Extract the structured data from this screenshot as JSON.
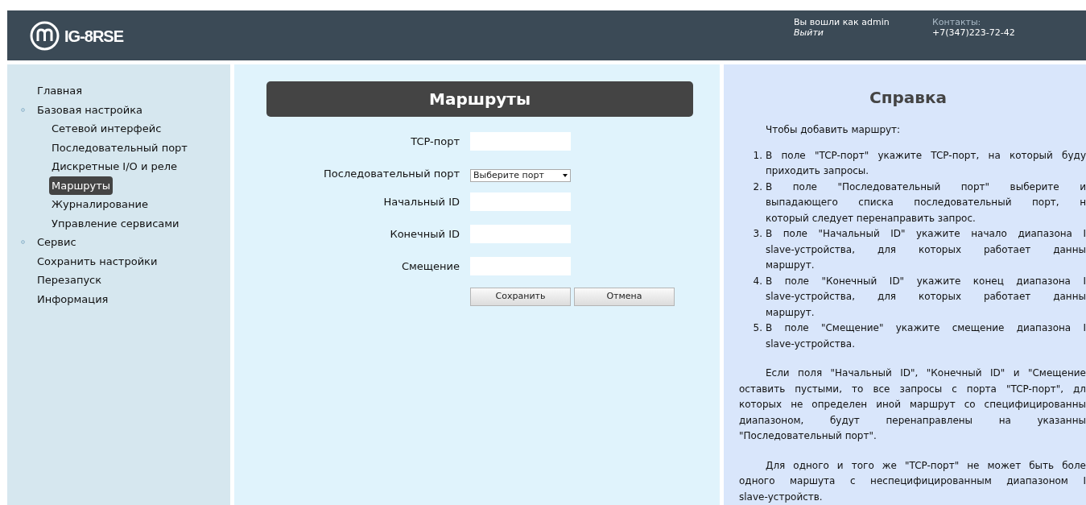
{
  "header": {
    "product": "IG-8RSE",
    "login_text": "Вы вошли как admin",
    "logout": "Выйти",
    "contacts_label": "Контакты:",
    "phone": "+7(347)223-72-42"
  },
  "sidebar": {
    "items": [
      {
        "label": "Главная",
        "kind": "link",
        "selected": false
      },
      {
        "label": "Базовая настройка",
        "kind": "group",
        "selected": false,
        "children": [
          {
            "label": "Сетевой интерфейс",
            "selected": false
          },
          {
            "label": "Последовательный порт",
            "selected": false
          },
          {
            "label": "Дискретные I/O и реле",
            "selected": false
          },
          {
            "label": "Маршруты",
            "selected": true
          },
          {
            "label": "Журналирование",
            "selected": false
          },
          {
            "label": "Управление сервисами",
            "selected": false
          }
        ]
      },
      {
        "label": "Сервис",
        "kind": "group",
        "selected": false
      },
      {
        "label": "Сохранить настройки",
        "kind": "link",
        "selected": false
      },
      {
        "label": "Перезапуск",
        "kind": "link",
        "selected": false
      },
      {
        "label": "Информация",
        "kind": "link",
        "selected": false
      }
    ]
  },
  "form": {
    "title": "Маршруты",
    "fields": [
      {
        "label": "TCP-порт",
        "kind": "text"
      },
      {
        "label": "Последовательный порт",
        "kind": "select",
        "value": "Выберите порт"
      },
      {
        "label": "Начальный ID",
        "kind": "text"
      },
      {
        "label": "Конечный ID",
        "kind": "text"
      },
      {
        "label": "Смещение",
        "kind": "text"
      }
    ],
    "buttons": [
      "Сохранить",
      "Отмена"
    ]
  },
  "help": {
    "title": "Справка",
    "intro": "Чтобы добавить маршрут:",
    "steps": [
      {
        "number": "1.",
        "lines": [
          "В поле \"TCP-порт\" укажите TCP-порт, на который буду",
          "приходить запросы."
        ]
      },
      {
        "number": "2.",
        "lines": [
          "В поле \"Последовательный порт\" выберите и",
          "выпадающего списка последовательный порт, н",
          "который следует перенаправить запрос."
        ]
      },
      {
        "number": "3.",
        "lines": [
          "В поле \"Начальный ID\" укажите начало диапазона I",
          "slave-устройства, для которых работает данны",
          "маршрут."
        ]
      },
      {
        "number": "4.",
        "lines": [
          "В поле \"Конечный ID\" укажите конец диапазона I",
          "slave-устройства, для которых работает данны",
          "маршрут."
        ]
      },
      {
        "number": "5.",
        "lines": [
          "В поле \"Смещение\" укажите смещение диапазона I",
          "slave-устройства."
        ]
      }
    ],
    "paragraphs": [
      {
        "lines": [
          "Если поля \"Начальный ID\", \"Конечный ID\" и \"Смещение",
          "оставить пустыми, то все запросы с порта \"TCP-порт\", дл",
          "которых не определен иной маршрут со специфицированны",
          "диапазоном, будут перенаправлены на указанны",
          "\"Последовательный порт\"."
        ]
      },
      {
        "lines": [
          "Для одного и того же \"TCP-порт\" не может быть боле",
          "одного маршута с неспецифицированным диапазоном I",
          "slave-устройств."
        ]
      }
    ]
  }
}
